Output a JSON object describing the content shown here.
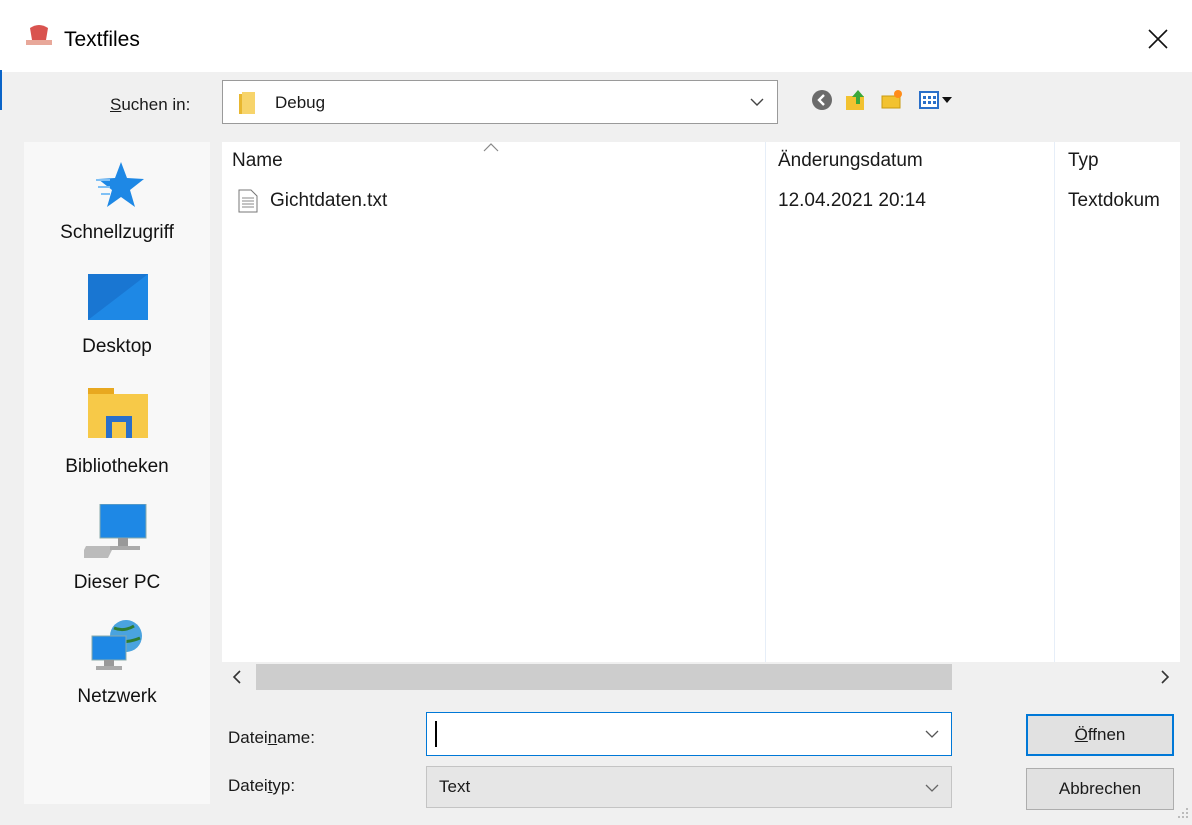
{
  "window": {
    "title": "Textfiles"
  },
  "toolbar": {
    "lookin_label_pre": "S",
    "lookin_label_post": "uchen in:",
    "lookin_value": "Debug",
    "icons": [
      "back-icon",
      "up-folder-icon",
      "new-folder-icon",
      "view-menu-icon"
    ]
  },
  "places": [
    {
      "label": "Schnellzugriff",
      "icon": "star-icon"
    },
    {
      "label": "Desktop",
      "icon": "desktop-icon"
    },
    {
      "label": "Bibliotheken",
      "icon": "libraries-icon"
    },
    {
      "label": "Dieser PC",
      "icon": "computer-icon"
    },
    {
      "label": "Netzwerk",
      "icon": "network-icon"
    }
  ],
  "filelist": {
    "columns": [
      "Name",
      "Änderungsdatum",
      "Typ"
    ],
    "rows": [
      {
        "name": "Gichtdaten.txt",
        "date": "12.04.2021 20:14",
        "type": "Textdokum"
      }
    ]
  },
  "form": {
    "filename_label_pre": "Datei",
    "filename_label_u": "n",
    "filename_label_post": "ame:",
    "filename_value": "",
    "filetype_label_pre": "Datei",
    "filetype_label_u": "t",
    "filetype_label_post": "yp:",
    "filetype_value": "Text"
  },
  "buttons": {
    "open_u": "Ö",
    "open_rest": "ffnen",
    "cancel": "Abbrechen"
  },
  "colors": {
    "accent": "#0078d7",
    "star": "#1e88e5",
    "folder": "#f7c948"
  }
}
